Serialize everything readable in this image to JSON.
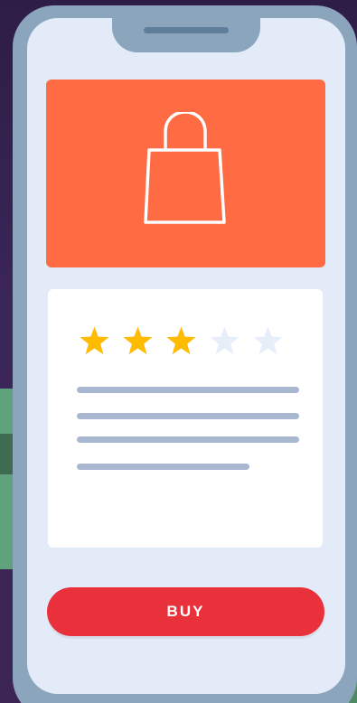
{
  "product": {
    "icon": "shopping-bag-icon",
    "hero_color": "#ff6b42"
  },
  "rating": {
    "value": 3,
    "max": 5,
    "filled_color": "#ffbb00",
    "empty_color": "#e6eefa"
  },
  "description": {
    "placeholder_lines": 4
  },
  "actions": {
    "buy_label": "BUY",
    "buy_color": "#e8313a"
  },
  "colors": {
    "phone_frame": "#8ba5bc",
    "screen_bg": "#e4ebf8",
    "card_bg": "#ffffff",
    "placeholder_line": "#aab7d1"
  }
}
